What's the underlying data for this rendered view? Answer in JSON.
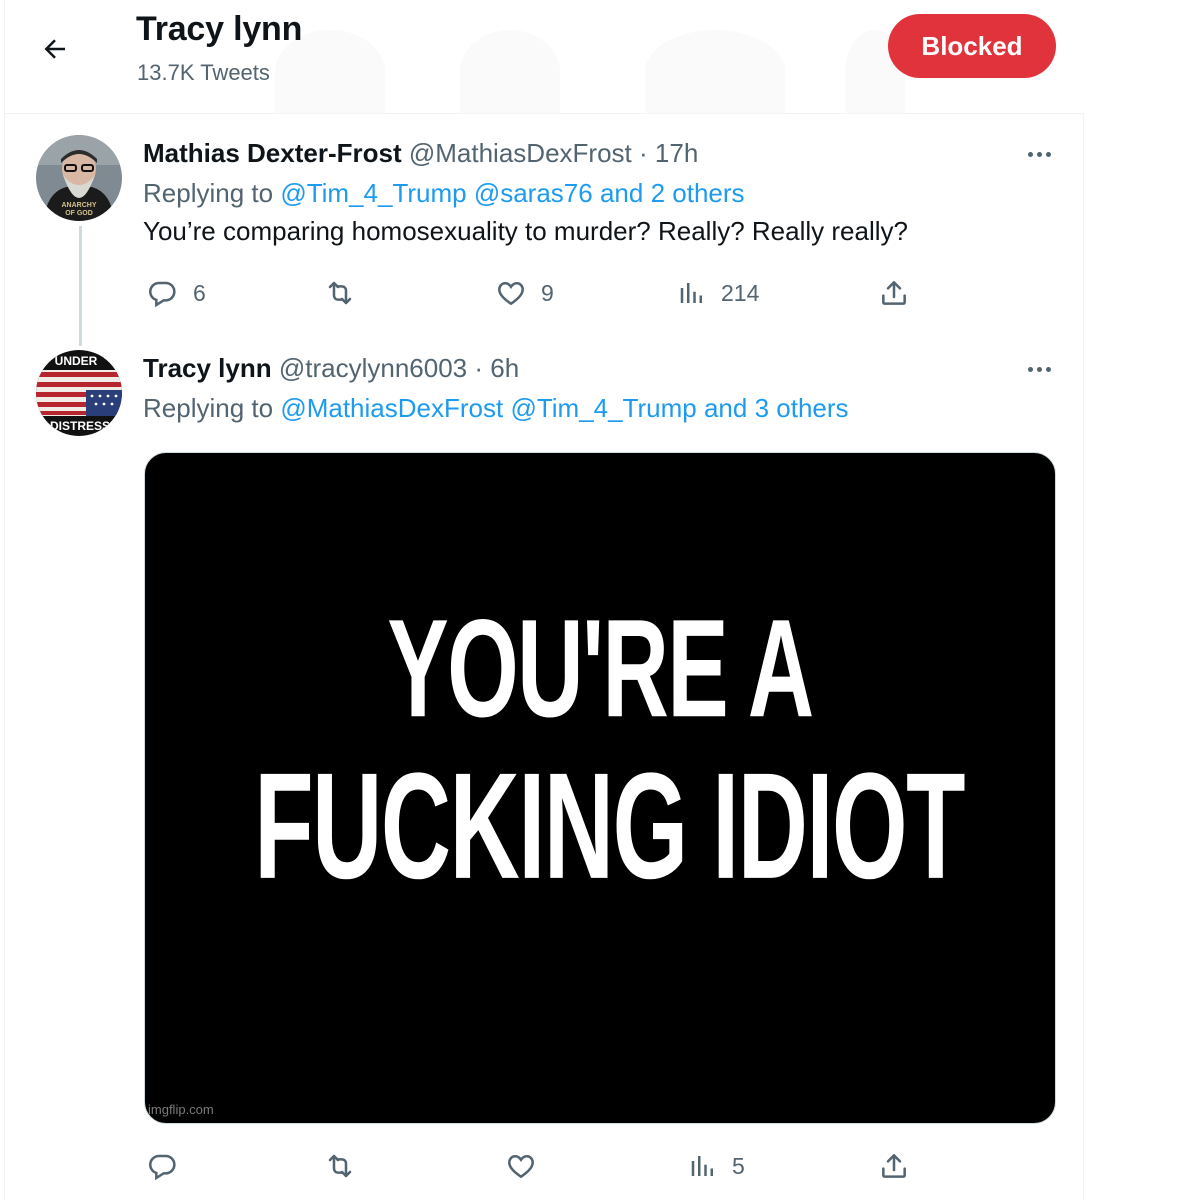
{
  "header": {
    "name": "Tracy lynn",
    "tweet_count": "13.7K Tweets",
    "blocked_label": "Blocked",
    "accent": "#e0333b"
  },
  "tweets": [
    {
      "name": "Mathias Dexter-Frost",
      "handle": "@MathiasDexFrost",
      "separator": "·",
      "time": "17h",
      "replying_prefix": "Replying to",
      "replying_links": [
        "@Tim_4_Trump",
        "@saras76",
        "and 2 others"
      ],
      "text": "You’re comparing homosexuality to murder? Really? Really really?",
      "avatar_text": [
        "ANARCHY",
        "OF GOD"
      ],
      "actions": {
        "replies": "6",
        "retweets": "",
        "likes": "9",
        "views": "214"
      }
    },
    {
      "name": "Tracy lynn",
      "handle": "@tracylynn6003",
      "separator": "·",
      "time": "6h",
      "replying_prefix": "Replying to",
      "replying_links": [
        "@MathiasDexFrost",
        "@Tim_4_Trump",
        "and 3 others"
      ],
      "avatar_text": [
        "UNDER",
        "DISTRESS"
      ],
      "media": {
        "line1": "YOU'RE A",
        "line2": "FUCKING IDIOT",
        "watermark": "imgflip.com"
      },
      "actions": {
        "replies": "",
        "retweets": "",
        "likes": "",
        "views": "5"
      }
    }
  ],
  "icons": [
    "back-arrow-icon",
    "more-icon",
    "reply-icon",
    "retweet-icon",
    "like-icon",
    "views-icon",
    "share-icon"
  ],
  "colors": {
    "link": "#1d9bf0",
    "secondary_text": "#536471",
    "border": "#eff3f4"
  }
}
